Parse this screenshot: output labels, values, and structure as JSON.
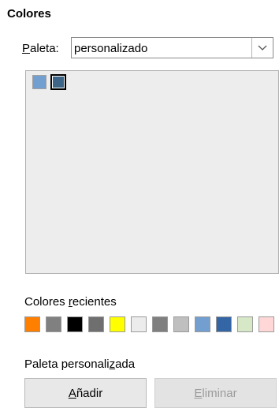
{
  "section": {
    "title": "Colores"
  },
  "palette": {
    "label_prefix": "",
    "label_accel": "P",
    "label_rest": "aleta:",
    "selected": "personalizado"
  },
  "swatches": [
    {
      "color": "#729fcf",
      "selected": false
    },
    {
      "color": "#3c6587",
      "selected": true
    }
  ],
  "recent": {
    "label_prefix": "Colores ",
    "label_accel": "r",
    "label_rest": "ecientes",
    "colors": [
      "#ff7f00",
      "#808080",
      "#000000",
      "#6f6f6f",
      "#ffff00",
      "#ececec",
      "#7f7f7f",
      "#bfbfbf",
      "#729fcf",
      "#3465a4",
      "#d6e8c6",
      "#ffd7d7"
    ]
  },
  "custom": {
    "label_prefix": "Paleta personali",
    "label_accel": "z",
    "label_rest": "ada"
  },
  "buttons": {
    "add_accel": "A",
    "add_rest": "ñadir",
    "remove_accel": "E",
    "remove_rest": "liminar"
  }
}
